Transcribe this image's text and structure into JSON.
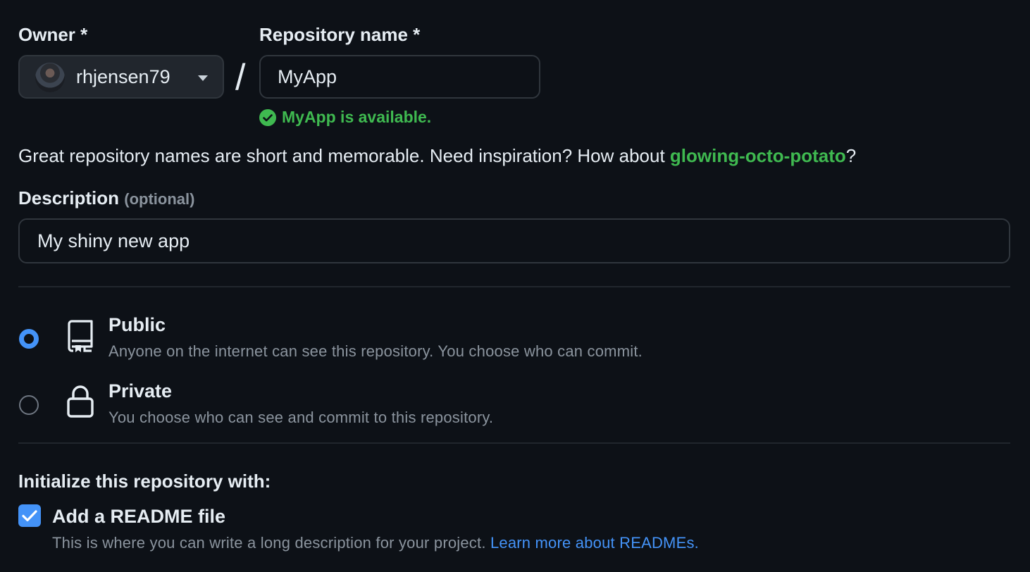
{
  "owner": {
    "label": "Owner *",
    "username": "rhjensen79"
  },
  "separator": "/",
  "repository": {
    "label": "Repository name *",
    "value": "MyApp",
    "availability": "MyApp is available."
  },
  "hint": {
    "text": "Great repository names are short and memorable. Need inspiration? How about ",
    "suggestion": "glowing-octo-potato",
    "suffix": "?"
  },
  "description": {
    "label": "Description",
    "optional": "(optional)",
    "value": "My shiny new app"
  },
  "visibility": {
    "selected": "public",
    "options": [
      {
        "key": "public",
        "title": "Public",
        "description": "Anyone on the internet can see this repository. You choose who can commit.",
        "icon": "repo-icon"
      },
      {
        "key": "private",
        "title": "Private",
        "description": "You choose who can see and commit to this repository.",
        "icon": "lock-icon"
      }
    ]
  },
  "initialize": {
    "label": "Initialize this repository with:",
    "readme": {
      "checked": true,
      "title": "Add a README file",
      "description": "This is where you can write a long description for your project. ",
      "link": "Learn more about READMEs."
    }
  },
  "colors": {
    "background": "#0d1117",
    "success": "#3fb950",
    "accent": "#4493f8",
    "muted": "#8b949e"
  }
}
